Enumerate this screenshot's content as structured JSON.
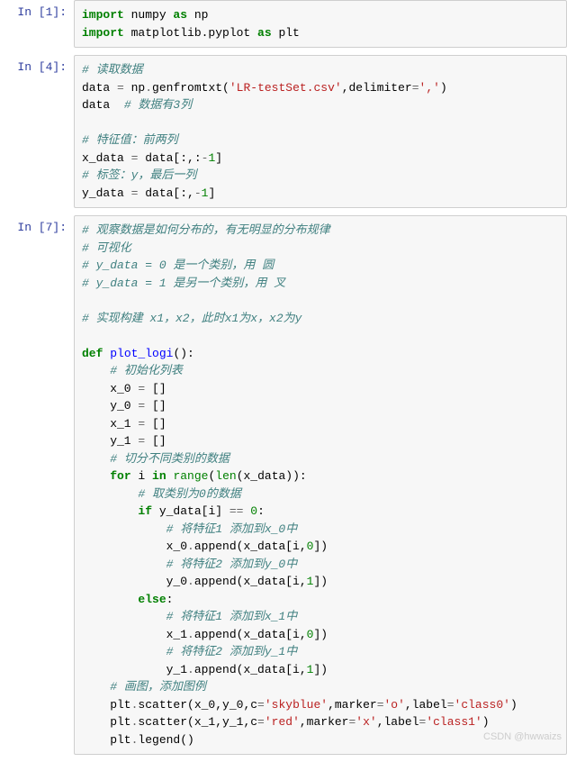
{
  "cells": [
    {
      "prompt": "In  [1]:",
      "lines": [
        [
          {
            "t": "import",
            "c": "kw"
          },
          {
            "t": " numpy ",
            "c": "nm"
          },
          {
            "t": "as",
            "c": "kw"
          },
          {
            "t": " np",
            "c": "nm"
          }
        ],
        [
          {
            "t": "import",
            "c": "kw"
          },
          {
            "t": " matplotlib.pyplot ",
            "c": "nm"
          },
          {
            "t": "as",
            "c": "kw"
          },
          {
            "t": " plt",
            "c": "nm"
          }
        ]
      ]
    },
    {
      "prompt": "In  [4]:",
      "lines": [
        [
          {
            "t": "# 读取数据",
            "c": "cmt"
          }
        ],
        [
          {
            "t": "data ",
            "c": "nm"
          },
          {
            "t": "=",
            "c": "op"
          },
          {
            "t": " np",
            "c": "nm"
          },
          {
            "t": ".",
            "c": "op"
          },
          {
            "t": "genfromtxt(",
            "c": "nm"
          },
          {
            "t": "'LR-testSet.csv'",
            "c": "str"
          },
          {
            "t": ",delimiter",
            "c": "nm"
          },
          {
            "t": "=",
            "c": "op"
          },
          {
            "t": "','",
            "c": "str"
          },
          {
            "t": ")",
            "c": "nm"
          }
        ],
        [
          {
            "t": "data  ",
            "c": "nm"
          },
          {
            "t": "# 数据有3列",
            "c": "cmt"
          }
        ],
        [
          {
            "t": "",
            "c": "nm"
          }
        ],
        [
          {
            "t": "# 特征值：前两列",
            "c": "cmt"
          }
        ],
        [
          {
            "t": "x_data ",
            "c": "nm"
          },
          {
            "t": "=",
            "c": "op"
          },
          {
            "t": " data[:,:",
            "c": "nm"
          },
          {
            "t": "-",
            "c": "op"
          },
          {
            "t": "1",
            "c": "num"
          },
          {
            "t": "]",
            "c": "nm"
          }
        ],
        [
          {
            "t": "# 标签：y，最后一列",
            "c": "cmt"
          }
        ],
        [
          {
            "t": "y_data ",
            "c": "nm"
          },
          {
            "t": "=",
            "c": "op"
          },
          {
            "t": " data[:,",
            "c": "nm"
          },
          {
            "t": "-",
            "c": "op"
          },
          {
            "t": "1",
            "c": "num"
          },
          {
            "t": "]",
            "c": "nm"
          }
        ]
      ]
    },
    {
      "prompt": "In  [7]:",
      "lines": [
        [
          {
            "t": "# 观察数据是如何分布的，有无明显的分布规律",
            "c": "cmt"
          }
        ],
        [
          {
            "t": "# 可视化",
            "c": "cmt"
          }
        ],
        [
          {
            "t": "# y_data = 0 是一个类别，用 圆",
            "c": "cmt"
          }
        ],
        [
          {
            "t": "# y_data = 1 是另一个类别，用 叉",
            "c": "cmt"
          }
        ],
        [
          {
            "t": "",
            "c": "nm"
          }
        ],
        [
          {
            "t": "# 实现构建 x1，x2，此时x1为x，x2为y",
            "c": "cmt"
          }
        ],
        [
          {
            "t": "",
            "c": "nm"
          }
        ],
        [
          {
            "t": "def",
            "c": "kw"
          },
          {
            "t": " ",
            "c": "nm"
          },
          {
            "t": "plot_logi",
            "c": "fn"
          },
          {
            "t": "():",
            "c": "nm"
          }
        ],
        [
          {
            "t": "    ",
            "c": "nm"
          },
          {
            "t": "# 初始化列表",
            "c": "cmt"
          }
        ],
        [
          {
            "t": "    x_0 ",
            "c": "nm"
          },
          {
            "t": "=",
            "c": "op"
          },
          {
            "t": " []",
            "c": "nm"
          }
        ],
        [
          {
            "t": "    y_0 ",
            "c": "nm"
          },
          {
            "t": "=",
            "c": "op"
          },
          {
            "t": " []",
            "c": "nm"
          }
        ],
        [
          {
            "t": "    x_1 ",
            "c": "nm"
          },
          {
            "t": "=",
            "c": "op"
          },
          {
            "t": " []",
            "c": "nm"
          }
        ],
        [
          {
            "t": "    y_1 ",
            "c": "nm"
          },
          {
            "t": "=",
            "c": "op"
          },
          {
            "t": " []",
            "c": "nm"
          }
        ],
        [
          {
            "t": "    ",
            "c": "nm"
          },
          {
            "t": "# 切分不同类别的数据",
            "c": "cmt"
          }
        ],
        [
          {
            "t": "    ",
            "c": "nm"
          },
          {
            "t": "for",
            "c": "kw"
          },
          {
            "t": " i ",
            "c": "nm"
          },
          {
            "t": "in",
            "c": "kw"
          },
          {
            "t": " ",
            "c": "nm"
          },
          {
            "t": "range",
            "c": "builtin"
          },
          {
            "t": "(",
            "c": "nm"
          },
          {
            "t": "len",
            "c": "builtin"
          },
          {
            "t": "(x_data)):",
            "c": "nm"
          }
        ],
        [
          {
            "t": "        ",
            "c": "nm"
          },
          {
            "t": "# 取类别为0的数据",
            "c": "cmt"
          }
        ],
        [
          {
            "t": "        ",
            "c": "nm"
          },
          {
            "t": "if",
            "c": "kw"
          },
          {
            "t": " y_data[i] ",
            "c": "nm"
          },
          {
            "t": "==",
            "c": "op"
          },
          {
            "t": " ",
            "c": "nm"
          },
          {
            "t": "0",
            "c": "num"
          },
          {
            "t": ":",
            "c": "nm"
          }
        ],
        [
          {
            "t": "            ",
            "c": "nm"
          },
          {
            "t": "# 将特征1 添加到x_0中",
            "c": "cmt"
          }
        ],
        [
          {
            "t": "            x_0",
            "c": "nm"
          },
          {
            "t": ".",
            "c": "op"
          },
          {
            "t": "append(x_data[i,",
            "c": "nm"
          },
          {
            "t": "0",
            "c": "num"
          },
          {
            "t": "])",
            "c": "nm"
          }
        ],
        [
          {
            "t": "            ",
            "c": "nm"
          },
          {
            "t": "# 将特征2 添加到y_0中",
            "c": "cmt"
          }
        ],
        [
          {
            "t": "            y_0",
            "c": "nm"
          },
          {
            "t": ".",
            "c": "op"
          },
          {
            "t": "append(x_data[i,",
            "c": "nm"
          },
          {
            "t": "1",
            "c": "num"
          },
          {
            "t": "])",
            "c": "nm"
          }
        ],
        [
          {
            "t": "        ",
            "c": "nm"
          },
          {
            "t": "else",
            "c": "kw"
          },
          {
            "t": ":",
            "c": "nm"
          }
        ],
        [
          {
            "t": "            ",
            "c": "nm"
          },
          {
            "t": "# 将特征1 添加到x_1中",
            "c": "cmt"
          }
        ],
        [
          {
            "t": "            x_1",
            "c": "nm"
          },
          {
            "t": ".",
            "c": "op"
          },
          {
            "t": "append(x_data[i,",
            "c": "nm"
          },
          {
            "t": "0",
            "c": "num"
          },
          {
            "t": "])",
            "c": "nm"
          }
        ],
        [
          {
            "t": "            ",
            "c": "nm"
          },
          {
            "t": "# 将特征2 添加到y_1中",
            "c": "cmt"
          }
        ],
        [
          {
            "t": "            y_1",
            "c": "nm"
          },
          {
            "t": ".",
            "c": "op"
          },
          {
            "t": "append(x_data[i,",
            "c": "nm"
          },
          {
            "t": "1",
            "c": "num"
          },
          {
            "t": "])",
            "c": "nm"
          }
        ],
        [
          {
            "t": "    ",
            "c": "nm"
          },
          {
            "t": "# 画图，添加图例",
            "c": "cmt"
          }
        ],
        [
          {
            "t": "    plt",
            "c": "nm"
          },
          {
            "t": ".",
            "c": "op"
          },
          {
            "t": "scatter(x_0,y_0,c",
            "c": "nm"
          },
          {
            "t": "=",
            "c": "op"
          },
          {
            "t": "'skyblue'",
            "c": "str"
          },
          {
            "t": ",marker",
            "c": "nm"
          },
          {
            "t": "=",
            "c": "op"
          },
          {
            "t": "'o'",
            "c": "str"
          },
          {
            "t": ",label",
            "c": "nm"
          },
          {
            "t": "=",
            "c": "op"
          },
          {
            "t": "'class0'",
            "c": "str"
          },
          {
            "t": ")",
            "c": "nm"
          }
        ],
        [
          {
            "t": "    plt",
            "c": "nm"
          },
          {
            "t": ".",
            "c": "op"
          },
          {
            "t": "scatter(x_1,y_1,c",
            "c": "nm"
          },
          {
            "t": "=",
            "c": "op"
          },
          {
            "t": "'red'",
            "c": "str"
          },
          {
            "t": ",marker",
            "c": "nm"
          },
          {
            "t": "=",
            "c": "op"
          },
          {
            "t": "'x'",
            "c": "str"
          },
          {
            "t": ",label",
            "c": "nm"
          },
          {
            "t": "=",
            "c": "op"
          },
          {
            "t": "'class1'",
            "c": "str"
          },
          {
            "t": ")",
            "c": "nm"
          }
        ],
        [
          {
            "t": "    plt",
            "c": "nm"
          },
          {
            "t": ".",
            "c": "op"
          },
          {
            "t": "legend()",
            "c": "nm"
          }
        ]
      ]
    }
  ],
  "watermark": "CSDN @hwwaizs"
}
